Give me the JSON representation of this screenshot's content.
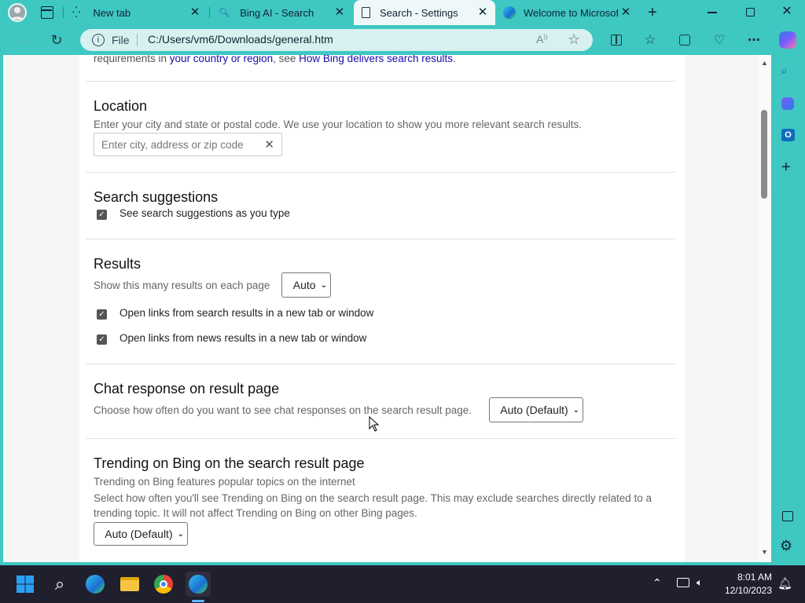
{
  "tabs": [
    {
      "label": "New tab"
    },
    {
      "label": "Bing AI - Search"
    },
    {
      "label": "Search - Settings"
    },
    {
      "label": "Welcome to Microsoft"
    }
  ],
  "address": {
    "scheme": "File",
    "url": "C:/Users/vm6/Downloads/general.htm"
  },
  "top_text": {
    "prefix": "requirements in ",
    "link1": "your country or region",
    "mid": ", see ",
    "link2": "How Bing delivers search results",
    "suffix": "."
  },
  "location": {
    "title": "Location",
    "desc": "Enter your city and state or postal code. We use your location to show you more relevant search results.",
    "placeholder": "Enter city, address or zip code"
  },
  "suggestions": {
    "title": "Search suggestions",
    "checkbox_label": "See search suggestions as you type",
    "checked": true
  },
  "results": {
    "title": "Results",
    "count_label": "Show this many results on each page",
    "count_value": "Auto",
    "links_label": "Open links from search results in a new tab or window",
    "news_label": "Open links from news results in a new tab or window"
  },
  "chat": {
    "title": "Chat response on result page",
    "desc": "Choose how often do you want to see chat responses on the search result page.",
    "value": "Auto (Default)"
  },
  "trending": {
    "title": "Trending on Bing on the search result page",
    "desc1": "Trending on Bing features popular topics on the internet",
    "desc2": "Select how often you'll see Trending on Bing on the search result page. This may exclude searches directly related to a trending topic. It will not affect Trending on Bing on other Bing pages.",
    "value": "Auto (Default)"
  },
  "clock": {
    "time": "8:01 AM",
    "date": "12/10/2023"
  },
  "colors": {
    "accent": "#3fc7c2",
    "link": "#1a0dab",
    "taskbar": "#1f1f2e"
  }
}
